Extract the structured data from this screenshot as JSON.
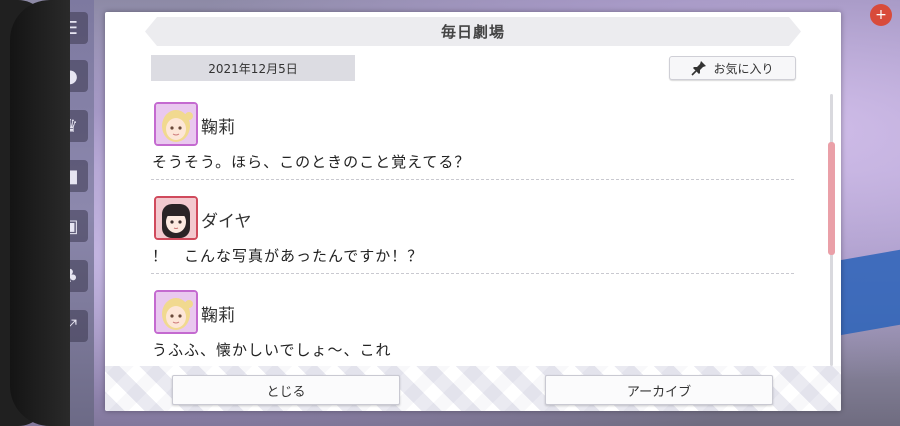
{
  "dialog": {
    "title": "毎日劇場",
    "date": "2021年12月5日",
    "favorite_label": "お気に入り"
  },
  "messages": [
    {
      "speaker": "鞠莉",
      "text": "そうそう。ほら、このときのこと覚えてる？",
      "avatar": "mari-avatar"
    },
    {
      "speaker": "ダイヤ",
      "text": "！　こんな写真があったんですか！？",
      "avatar": "dia-avatar"
    },
    {
      "speaker": "鞠莉",
      "text": "うふふ、懐かしいでしょ〜、これ",
      "avatar": "mari-avatar"
    }
  ],
  "footer": {
    "close_label": "とじる",
    "archive_label": "アーカイブ"
  },
  "colors": {
    "accent_scroll": "#eaa0a8",
    "avatar_border_purple": "#c46ad0",
    "avatar_border_red": "#d04a5c"
  },
  "icons": [
    "menu-icon",
    "pin-icon",
    "scroll-thumb"
  ]
}
